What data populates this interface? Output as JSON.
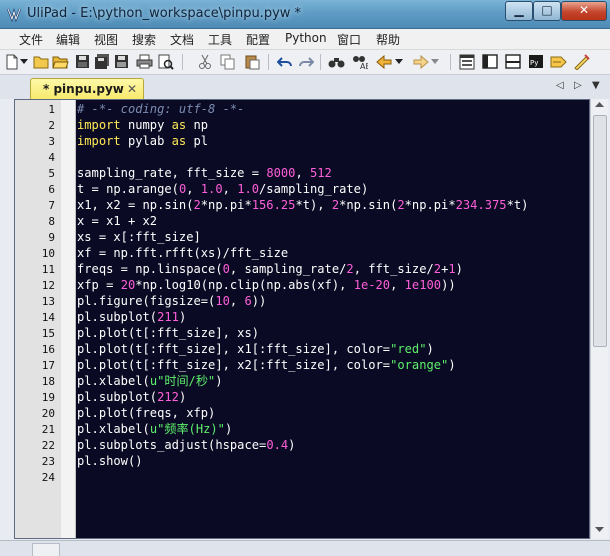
{
  "window": {
    "title": "UliPad - E:\\python_workspace\\pinpu.pyw *",
    "buttons": {
      "minimize": "▁",
      "maximize": "□",
      "close": "✕"
    }
  },
  "menu": [
    "文件",
    "编辑",
    "视图",
    "搜索",
    "文档",
    "工具",
    "配置",
    "Python",
    "窗口",
    "帮助"
  ],
  "toolbar": {
    "icons": [
      "new-file-icon",
      "open-folder-icon",
      "save-icon",
      "save-all-icon",
      "print-icon",
      "print-preview-icon",
      "cut-icon",
      "copy-icon",
      "paste-icon",
      "undo-icon",
      "redo-icon",
      "find-icon",
      "replace-icon",
      "back-icon",
      "forward-icon",
      "properties-icon",
      "panel-left-icon",
      "panel-bottom-icon",
      "python-shell-icon",
      "run-icon",
      "settings-icon"
    ]
  },
  "tab": {
    "label": "* pinpu.pyw",
    "close": "✕",
    "prev": "◁",
    "next": "▷",
    "menu": "▼"
  },
  "gutter": {
    "line_numbers": [
      "1",
      "2",
      "3",
      "4",
      "5",
      "6",
      "7",
      "8",
      "9",
      "10",
      "11",
      "12",
      "13",
      "14",
      "15",
      "16",
      "17",
      "18",
      "19",
      "20",
      "21",
      "22",
      "23",
      "24"
    ]
  },
  "code": {
    "lines": [
      [
        {
          "t": "# -*- coding: utf-8 -*-",
          "k": "comment"
        }
      ],
      [
        {
          "t": "import",
          "k": "kw"
        },
        {
          "t": " numpy ",
          "k": "id"
        },
        {
          "t": "as",
          "k": "kw"
        },
        {
          "t": " np",
          "k": "id"
        }
      ],
      [
        {
          "t": "import",
          "k": "kw"
        },
        {
          "t": " pylab ",
          "k": "id"
        },
        {
          "t": "as",
          "k": "kw"
        },
        {
          "t": " pl",
          "k": "id"
        }
      ],
      [],
      [
        {
          "t": "sampling_rate, fft_size = ",
          "k": "id"
        },
        {
          "t": "8000",
          "k": "num"
        },
        {
          "t": ", ",
          "k": "id"
        },
        {
          "t": "512",
          "k": "num"
        }
      ],
      [
        {
          "t": "t = np.arange(",
          "k": "id"
        },
        {
          "t": "0",
          "k": "num"
        },
        {
          "t": ", ",
          "k": "id"
        },
        {
          "t": "1.0",
          "k": "num"
        },
        {
          "t": ", ",
          "k": "id"
        },
        {
          "t": "1.0",
          "k": "num"
        },
        {
          "t": "/sampling_rate)",
          "k": "id"
        }
      ],
      [
        {
          "t": "x1, x2 = np.sin(",
          "k": "id"
        },
        {
          "t": "2",
          "k": "num"
        },
        {
          "t": "*np.pi*",
          "k": "id"
        },
        {
          "t": "156.25",
          "k": "num"
        },
        {
          "t": "*t), ",
          "k": "id"
        },
        {
          "t": "2",
          "k": "num"
        },
        {
          "t": "*np.sin(",
          "k": "id"
        },
        {
          "t": "2",
          "k": "num"
        },
        {
          "t": "*np.pi*",
          "k": "id"
        },
        {
          "t": "234.375",
          "k": "num"
        },
        {
          "t": "*t)",
          "k": "id"
        }
      ],
      [
        {
          "t": "x = x1 + x2",
          "k": "id"
        }
      ],
      [
        {
          "t": "xs = x[:fft_size]",
          "k": "id"
        }
      ],
      [
        {
          "t": "xf = np.fft.rfft(xs)/fft_size",
          "k": "id"
        }
      ],
      [
        {
          "t": "freqs = np.linspace(",
          "k": "id"
        },
        {
          "t": "0",
          "k": "num"
        },
        {
          "t": ", sampling_rate/",
          "k": "id"
        },
        {
          "t": "2",
          "k": "num"
        },
        {
          "t": ", fft_size/",
          "k": "id"
        },
        {
          "t": "2",
          "k": "num"
        },
        {
          "t": "+",
          "k": "id"
        },
        {
          "t": "1",
          "k": "num"
        },
        {
          "t": ")",
          "k": "id"
        }
      ],
      [
        {
          "t": "xfp = ",
          "k": "id"
        },
        {
          "t": "20",
          "k": "num"
        },
        {
          "t": "*np.log10(np.clip(np.abs(xf), ",
          "k": "id"
        },
        {
          "t": "1e-20",
          "k": "num"
        },
        {
          "t": ", ",
          "k": "id"
        },
        {
          "t": "1e100",
          "k": "num"
        },
        {
          "t": "))",
          "k": "id"
        }
      ],
      [
        {
          "t": "pl.figure(figsize=(",
          "k": "id"
        },
        {
          "t": "10",
          "k": "num"
        },
        {
          "t": ", ",
          "k": "id"
        },
        {
          "t": "6",
          "k": "num"
        },
        {
          "t": "))",
          "k": "id"
        }
      ],
      [
        {
          "t": "pl.subplot(",
          "k": "id"
        },
        {
          "t": "211",
          "k": "num"
        },
        {
          "t": ")",
          "k": "id"
        }
      ],
      [
        {
          "t": "pl.plot(t[:fft_size], xs)",
          "k": "id"
        }
      ],
      [
        {
          "t": "pl.plot(t[:fft_size], x1[:fft_size], color=",
          "k": "id"
        },
        {
          "t": "\"red\"",
          "k": "str"
        },
        {
          "t": ")",
          "k": "id"
        }
      ],
      [
        {
          "t": "pl.plot(t[:fft_size], x2[:fft_size], color=",
          "k": "id"
        },
        {
          "t": "\"orange\"",
          "k": "str"
        },
        {
          "t": ")",
          "k": "id"
        }
      ],
      [
        {
          "t": "pl.xlabel(",
          "k": "id"
        },
        {
          "t": "u\"时间/秒\"",
          "k": "str"
        },
        {
          "t": ")",
          "k": "id"
        }
      ],
      [
        {
          "t": "pl.subplot(",
          "k": "id"
        },
        {
          "t": "212",
          "k": "num"
        },
        {
          "t": ")",
          "k": "id"
        }
      ],
      [
        {
          "t": "pl.plot(freqs, xfp)",
          "k": "id"
        }
      ],
      [
        {
          "t": "pl.xlabel(",
          "k": "id"
        },
        {
          "t": "u\"频率(Hz)\"",
          "k": "str"
        },
        {
          "t": ")",
          "k": "id"
        }
      ],
      [
        {
          "t": "pl.subplots_adjust(hspace=",
          "k": "id"
        },
        {
          "t": "0.4",
          "k": "num"
        },
        {
          "t": ")",
          "k": "id"
        }
      ],
      [
        {
          "t": "pl.show()",
          "k": "id"
        }
      ],
      []
    ]
  },
  "colors": {
    "editor_bg": "#0b0a24",
    "keyword": "#ffe955",
    "number": "#ff5fd8",
    "string": "#5df06b",
    "comment": "#7c8cb0"
  }
}
